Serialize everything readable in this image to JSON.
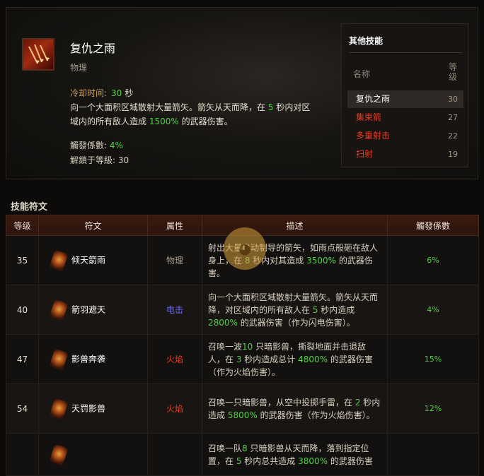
{
  "skill": {
    "name": "复仇之雨",
    "type": "物理",
    "cooldown_label": "冷却时间:",
    "cooldown_value": "30",
    "cooldown_unit": "秒",
    "desc_part1": "向一个大面积区域散射大量箭矢。箭矢从天而降，在",
    "desc_seconds": "5",
    "desc_part2": "秒内对区域内的所有敌人造成",
    "desc_damage": "1500%",
    "desc_part3": "的武器伤害。",
    "proc_label": "觸發係數:",
    "proc_value": "4%",
    "unlock_text": "解鎖于等級: 30"
  },
  "other_skills": {
    "title": "其他技能",
    "col_name": "名称",
    "col_level": "等级",
    "items": [
      {
        "name": "复仇之雨",
        "level": "30",
        "color": "#ffffff"
      },
      {
        "name": "集束箭",
        "level": "27",
        "color": "#ef3a20"
      },
      {
        "name": "多重射击",
        "level": "22",
        "color": "#ef3a20"
      },
      {
        "name": "扫射",
        "level": "19",
        "color": "#ef3a20"
      }
    ]
  },
  "runes": {
    "section_title": "技能符文",
    "headers": {
      "level": "等级",
      "rune": "符文",
      "element": "属性",
      "desc": "描述",
      "proc": "觸發係數"
    },
    "rows": [
      {
        "level": "35",
        "name": "倾天箭雨",
        "element": "物理",
        "element_color": "#a49a88",
        "desc": [
          {
            "t": "射出大量自动制导的箭矢，如雨点般砸在敌人身上，在 "
          },
          {
            "t": "8",
            "hl": true
          },
          {
            "t": " 秒内对其造成 "
          },
          {
            "t": "3500%",
            "hl": true
          },
          {
            "t": " 的武器伤害。"
          }
        ],
        "proc": "6%"
      },
      {
        "level": "40",
        "name": "箭羽遮天",
        "element": "电击",
        "element_color": "#6a6cff",
        "desc": [
          {
            "t": "向一个大面积区域散射大量箭矢。箭矢从天而降，对区域内的所有敌人在 "
          },
          {
            "t": "5",
            "hl": true
          },
          {
            "t": " 秒内造成 "
          },
          {
            "t": "2800%",
            "hl": true
          },
          {
            "t": " 的武器伤害（作为闪电伤害）。"
          }
        ],
        "proc": "4%"
      },
      {
        "level": "47",
        "name": "影兽奔袭",
        "element": "火焰",
        "element_color": "#ef3a20",
        "desc": [
          {
            "t": "召唤一波"
          },
          {
            "t": "10",
            "hl": true
          },
          {
            "t": " 只暗影兽，撕裂地面并击退敌人，在 "
          },
          {
            "t": "3",
            "hl": true
          },
          {
            "t": " 秒内造成总计 "
          },
          {
            "t": "4800%",
            "hl": true
          },
          {
            "t": " 的武器伤害（作为火焰伤害）。"
          }
        ],
        "proc": "15%"
      },
      {
        "level": "54",
        "name": "天罚影兽",
        "element": "火焰",
        "element_color": "#ef3a20",
        "desc": [
          {
            "t": "召唤一只暗影兽，从空中投掷手雷，在 "
          },
          {
            "t": "2",
            "hl": true
          },
          {
            "t": " 秒内造成 "
          },
          {
            "t": "5800%",
            "hl": true
          },
          {
            "t": " 的武器伤害（作为火焰伤害）。"
          }
        ],
        "proc": "12%"
      },
      {
        "level": "",
        "name": "",
        "element": "",
        "element_color": "#ef3a20",
        "desc": [
          {
            "t": "召唤一队"
          },
          {
            "t": "8",
            "hl": true
          },
          {
            "t": " 只暗影兽从天而降，落到指定位置，在 "
          },
          {
            "t": "5",
            "hl": true
          },
          {
            "t": " 秒内总共造成 "
          },
          {
            "t": "3800%",
            "hl": true
          },
          {
            "t": " 的武器伤害"
          }
        ],
        "proc": ""
      }
    ]
  }
}
